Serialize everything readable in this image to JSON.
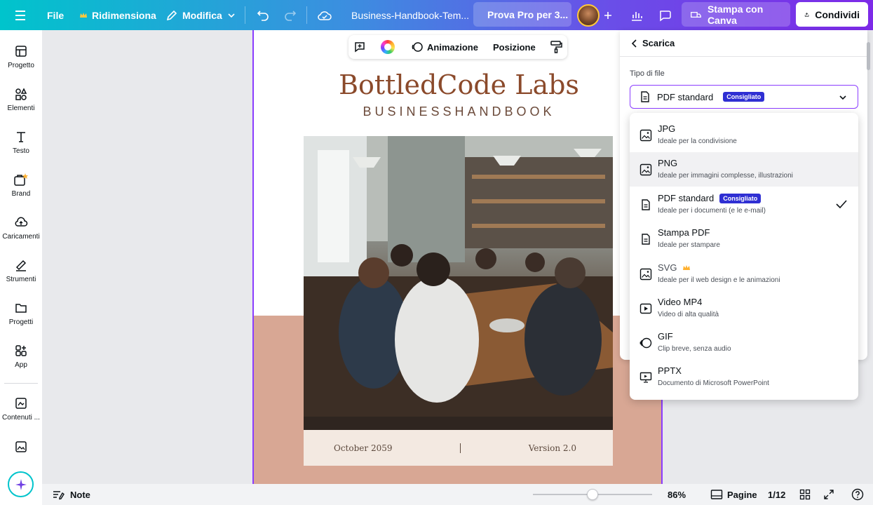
{
  "topbar": {
    "file": "File",
    "resize": "Ridimensiona",
    "edit": "Modifica",
    "doc_title": "Business-Handbook-Tem...",
    "pro": "Prova Pro per 3...",
    "print": "Stampa con Canva",
    "share": "Condividi"
  },
  "rail": {
    "items": [
      {
        "label": "Progetto",
        "icon": "layout-icon"
      },
      {
        "label": "Elementi",
        "icon": "shapes-icon"
      },
      {
        "label": "Testo",
        "icon": "text-icon"
      },
      {
        "label": "Brand",
        "icon": "brand-icon"
      },
      {
        "label": "Caricamenti",
        "icon": "cloud-upload-icon"
      },
      {
        "label": "Strumenti",
        "icon": "draw-icon"
      },
      {
        "label": "Progetti",
        "icon": "folder-icon"
      },
      {
        "label": "App",
        "icon": "apps-icon"
      },
      {
        "label": "Contenuti ...",
        "icon": "content-icon"
      }
    ]
  },
  "floating_toolbar": {
    "animation": "Animazione",
    "position": "Posizione"
  },
  "page": {
    "title": "BottledCode Labs",
    "subtitle": "BUSINESSHANDBOOK",
    "footer_left": "October 2059",
    "footer_right": "Version 2.0"
  },
  "bottombar": {
    "notes": "Note",
    "zoom": "86%",
    "pages": "Pagine",
    "page_count": "1/12",
    "zoom_fraction": 0.5
  },
  "panel": {
    "back_label": "Scarica",
    "file_type_label": "Tipo di file",
    "selected": "PDF standard",
    "recommended": "Consigliato"
  },
  "dropdown": {
    "options": [
      {
        "name": "JPG",
        "desc": "Ideale per la condivisione",
        "icon": "image-icon"
      },
      {
        "name": "PNG",
        "desc": "Ideale per immagini complesse, illustrazioni",
        "icon": "image-icon"
      },
      {
        "name": "PDF standard",
        "desc": "Ideale per i documenti (e le e-mail)",
        "icon": "document-icon",
        "badge": "Consigliato",
        "checked": true
      },
      {
        "name": "Stampa PDF",
        "desc": "Ideale per stampare",
        "icon": "document-icon"
      },
      {
        "name": "SVG",
        "desc": "Ideale per il web design e le animazioni",
        "icon": "image-icon",
        "pro": true
      },
      {
        "name": "Video MP4",
        "desc": "Video di alta qualità",
        "icon": "video-icon"
      },
      {
        "name": "GIF",
        "desc": "Clip breve, senza audio",
        "icon": "gif-icon"
      },
      {
        "name": "PPTX",
        "desc": "Documento di Microsoft PowerPoint",
        "icon": "presentation-icon"
      }
    ]
  },
  "colors": {
    "accent": "#8b3dff",
    "badge": "#2f2fd3",
    "brand_title": "#8b4a2b",
    "band": "#d8a794"
  }
}
